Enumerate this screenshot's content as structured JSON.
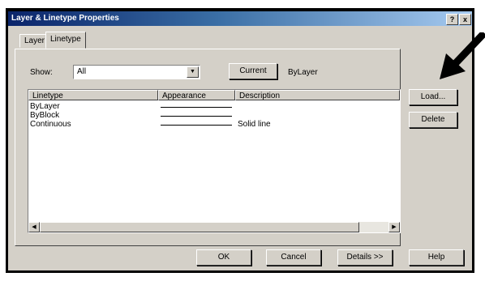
{
  "window": {
    "title": "Layer & Linetype Properties",
    "help_glyph": "?",
    "close_glyph": "x"
  },
  "tabs": [
    {
      "label": "Layer"
    },
    {
      "label": "Linetype"
    }
  ],
  "filter": {
    "show_label": "Show:",
    "show_value": "All",
    "current_button": "Current",
    "current_value": "ByLayer"
  },
  "list": {
    "columns": [
      "Linetype",
      "Appearance",
      "Description"
    ],
    "rows": [
      {
        "name": "ByLayer",
        "description": ""
      },
      {
        "name": "ByBlock",
        "description": ""
      },
      {
        "name": "Continuous",
        "description": "Solid line"
      }
    ]
  },
  "side_buttons": {
    "load": "Load...",
    "delete": "Delete"
  },
  "footer": {
    "ok": "OK",
    "cancel": "Cancel",
    "details": "Details >>",
    "help": "Help"
  }
}
